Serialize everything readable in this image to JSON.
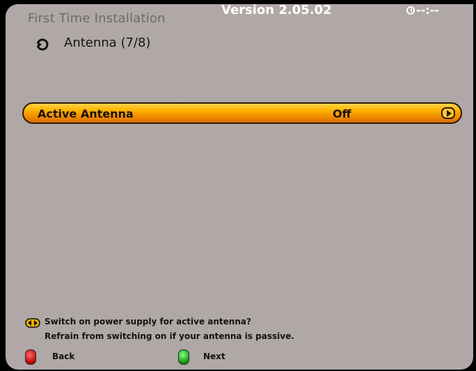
{
  "header": {
    "title": "First Time Installation",
    "version": "Version 2.05.02",
    "clock": "--:--"
  },
  "step": {
    "label": "Antenna",
    "count": "(7/8)"
  },
  "menu": {
    "rows": [
      {
        "label": "Active Antenna",
        "value": "Off"
      }
    ]
  },
  "help": {
    "line1": "Switch on power supply for active antenna?",
    "line2": "Refrain from switching on if your antenna is passive."
  },
  "footer": {
    "back_label": "Back",
    "next_label": "Next"
  },
  "colors": {
    "background": "#b0a8a6",
    "highlight": "#ffb300",
    "red_key": "#c41010",
    "green_key": "#18a818"
  }
}
